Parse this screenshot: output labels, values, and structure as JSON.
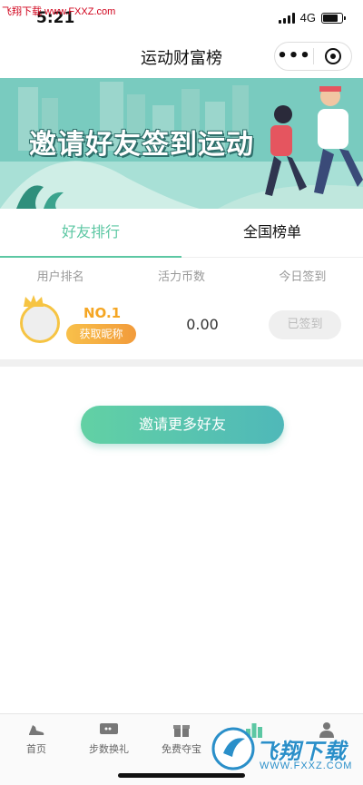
{
  "status_bar": {
    "time": "5:21",
    "network": "4G",
    "watermark": "飞翔下载 www.FXXZ.com"
  },
  "nav": {
    "title": "运动财富榜",
    "more_label": "•••"
  },
  "banner": {
    "headline": "邀请好友签到运动"
  },
  "tabs": [
    {
      "label": "好友排行",
      "active": true
    },
    {
      "label": "全国榜单",
      "active": false
    }
  ],
  "table": {
    "headers": [
      "用户排名",
      "活力币数",
      "今日签到"
    ],
    "rows": [
      {
        "rank": "NO.1",
        "nickname_button": "获取昵称",
        "coins": "0.00",
        "sign_status": "已签到"
      }
    ]
  },
  "invite_button": "邀请更多好友",
  "tabbar": [
    {
      "label": "首页",
      "icon": "shoe-icon"
    },
    {
      "label": "步数换礼",
      "icon": "ticket-icon"
    },
    {
      "label": "免费夺宝",
      "icon": "gift-icon"
    },
    {
      "label": "",
      "icon": "chart-icon"
    },
    {
      "label": "",
      "icon": "user-icon"
    }
  ],
  "watermark_bottom": {
    "text": "飞翔下载",
    "url": "WWW.FXXZ.COM"
  },
  "colors": {
    "accent": "#5cc7a3",
    "gold": "#f5a623",
    "banner_bg": "#66c3b5"
  }
}
